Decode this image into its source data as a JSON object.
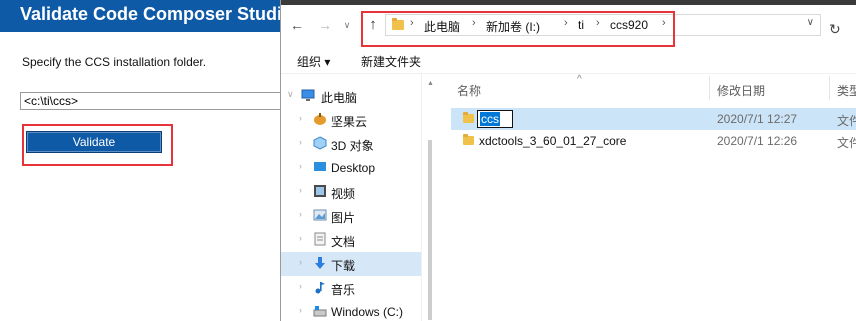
{
  "ccs_dialog": {
    "title": "Validate Code Composer Studio",
    "instruction": "Specify the CCS installation folder.",
    "path_value": "<c:\\ti\\ccs>",
    "validate_label": "Validate"
  },
  "explorer": {
    "breadcrumb": [
      "此电脑",
      "新加卷 (I:)",
      "ti",
      "ccs920"
    ],
    "toolbar": {
      "organize": "组织 ▾",
      "new_folder": "新建文件夹"
    },
    "columns": {
      "name": "名称",
      "date": "修改日期",
      "type": "类型"
    },
    "nav_tree": [
      {
        "label": "此电脑",
        "icon": "computer-icon"
      },
      {
        "label": "坚果云",
        "icon": "nutstore-icon"
      },
      {
        "label": "3D 对象",
        "icon": "3d-objects-icon"
      },
      {
        "label": "Desktop",
        "icon": "desktop-icon"
      },
      {
        "label": "视频",
        "icon": "video-icon"
      },
      {
        "label": "图片",
        "icon": "pictures-icon"
      },
      {
        "label": "文档",
        "icon": "documents-icon"
      },
      {
        "label": "下载",
        "icon": "download-icon"
      },
      {
        "label": "音乐",
        "icon": "music-icon"
      },
      {
        "label": "Windows (C:)",
        "icon": "drive-icon"
      }
    ],
    "files": [
      {
        "name": "ccs",
        "date": "2020/7/1 12:27",
        "type": "文件"
      },
      {
        "name": "xdctools_3_60_01_27_core",
        "date": "2020/7/1 12:26",
        "type": "文件"
      }
    ],
    "colors": {
      "dialog_blue": "#0f5aa6",
      "highlight_red": "#e8333a",
      "selection": "#cce4f7"
    }
  }
}
